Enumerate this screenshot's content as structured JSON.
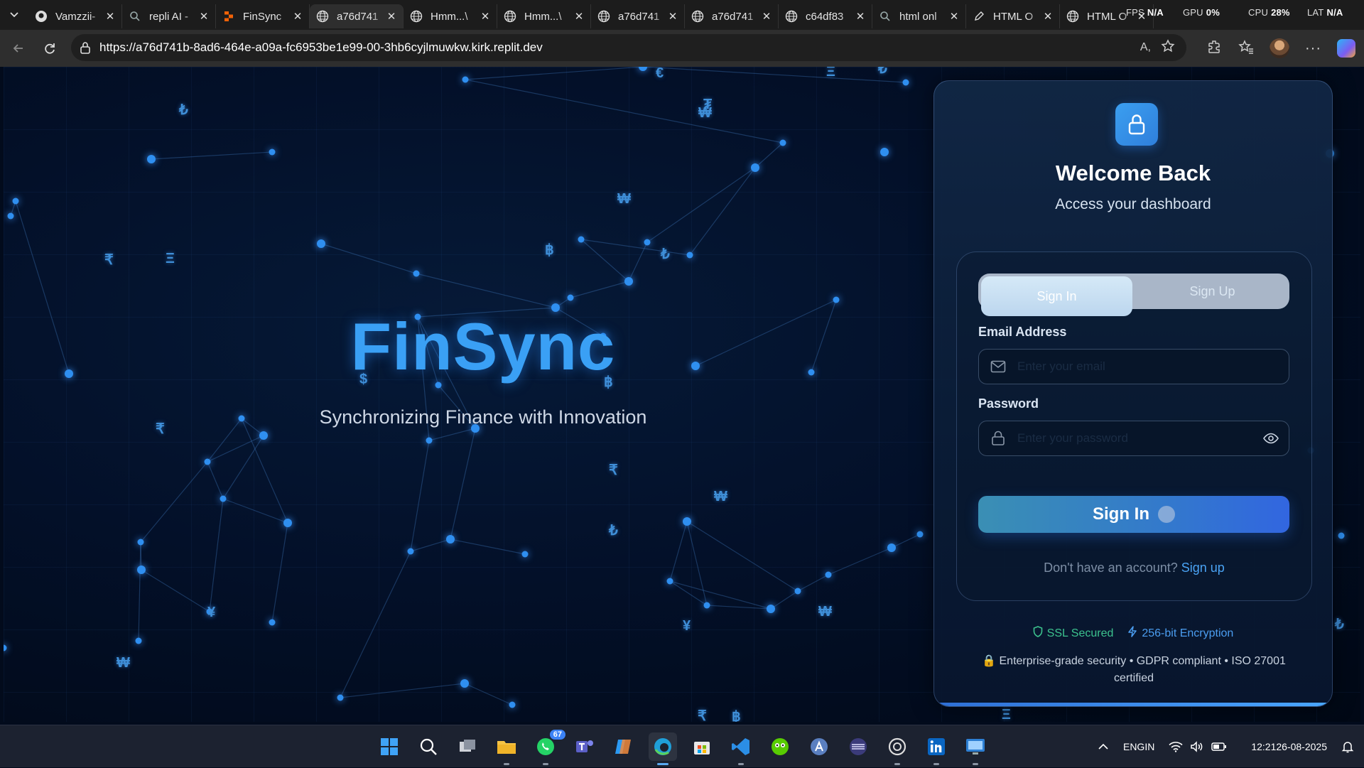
{
  "browser": {
    "tabs": [
      {
        "label": "Vamzzii-",
        "icon": "github-icon",
        "active": false
      },
      {
        "label": "repli AI -",
        "icon": "search-icon",
        "active": false
      },
      {
        "label": "FinSync",
        "icon": "replit-icon",
        "active": false
      },
      {
        "label": "a76d741",
        "icon": "globe-icon",
        "active": true
      },
      {
        "label": "Hmm...\\",
        "icon": "globe-icon",
        "active": false
      },
      {
        "label": "Hmm...\\",
        "icon": "globe-icon",
        "active": false
      },
      {
        "label": "a76d741",
        "icon": "globe-icon",
        "active": false
      },
      {
        "label": "a76d741",
        "icon": "globe-icon",
        "active": false
      },
      {
        "label": "c64df83",
        "icon": "globe-icon",
        "active": false
      },
      {
        "label": "html onl",
        "icon": "search-icon",
        "active": false
      },
      {
        "label": "HTML O",
        "icon": "document-icon",
        "active": false
      },
      {
        "label": "HTML O",
        "icon": "globe-icon",
        "active": false
      }
    ],
    "overlay": {
      "fps_label": "FPS",
      "fps_value": "N/A",
      "gpu_label": "GPU",
      "gpu_value": "0%",
      "cpu_label": "CPU",
      "cpu_value": "28%",
      "lat_label": "LAT",
      "lat_value": "N/A"
    },
    "url": "https://a76d741b-8ad6-464e-a09a-fc6953be1e99-00-3hb6cyjlmuwkw.kirk.replit.dev"
  },
  "hero": {
    "title": "FinSync",
    "tagline": "Synchronizing Finance with Innovation",
    "currency_symbols": [
      "₮",
      "₩",
      "€",
      "Ξ",
      "₺",
      "₩",
      "฿",
      "₺",
      "₹",
      "Ξ",
      "$",
      "฿",
      "₹",
      "₹",
      "₩",
      "₺",
      "¥",
      "₩",
      "₩",
      "¥",
      "₹",
      "฿",
      "Ξ",
      "₺",
      "₺"
    ]
  },
  "login": {
    "heading": "Welcome Back",
    "subheading": "Access your dashboard",
    "toggle": {
      "signin_label": "Sign In",
      "signup_label": "Sign Up",
      "selected": "Sign In"
    },
    "email": {
      "label": "Email Address",
      "placeholder": "Enter your email",
      "value": ""
    },
    "password": {
      "label": "Password",
      "placeholder": "Enter your password",
      "value": ""
    },
    "submit_label": "Sign In",
    "no_account_text": "Don't have an account?",
    "signup_link": "Sign up",
    "badges": {
      "ssl": "SSL Secured",
      "encryption": "256-bit Encryption"
    },
    "security_note": "Enterprise-grade security • GDPR compliant • ISO 27001 certified"
  },
  "taskbar": {
    "apps": [
      {
        "name": "windows-start-icon"
      },
      {
        "name": "search-icon"
      },
      {
        "name": "task-view-icon"
      },
      {
        "name": "file-explorer-icon"
      },
      {
        "name": "whatsapp-icon",
        "badge": "67"
      },
      {
        "name": "teams-icon"
      },
      {
        "name": "copilot-icon"
      },
      {
        "name": "edge-icon"
      },
      {
        "name": "store-icon"
      },
      {
        "name": "vscode-icon"
      },
      {
        "name": "duolingo-icon"
      },
      {
        "name": "app-a-icon"
      },
      {
        "name": "media-icon"
      },
      {
        "name": "chatgpt-icon"
      },
      {
        "name": "linkedin-icon"
      },
      {
        "name": "remote-desktop-icon"
      }
    ],
    "language": "ENG",
    "region": "IN",
    "time": "12:21",
    "date": "26-08-2025"
  },
  "colors": {
    "accent": "#3aa0f5",
    "background": "#020b1c",
    "ssl_green": "#3cc28e",
    "link_blue": "#4aa3f4"
  }
}
